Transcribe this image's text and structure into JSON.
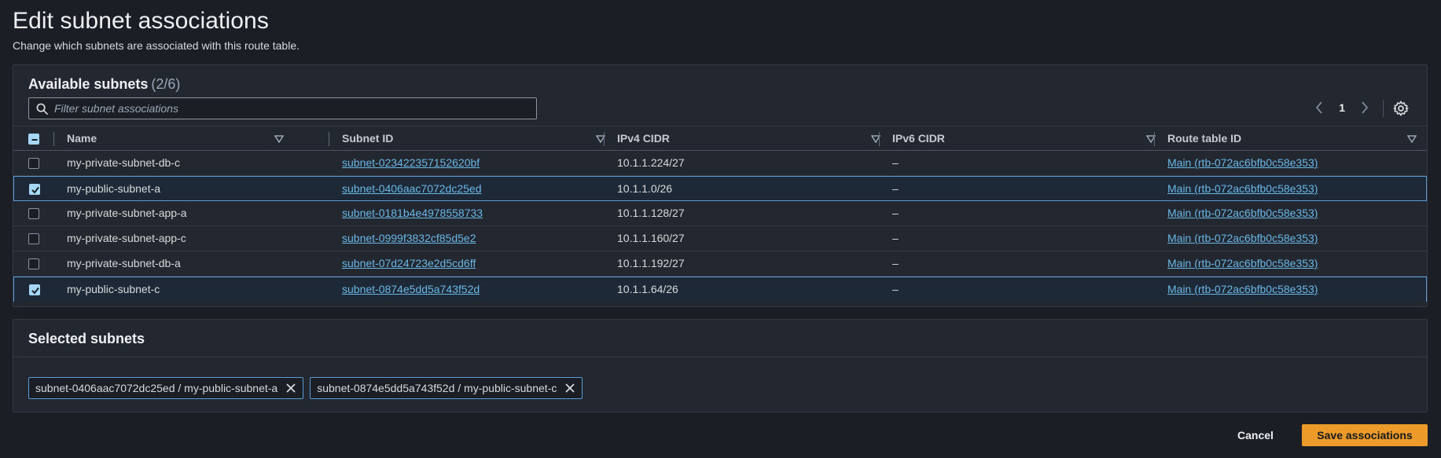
{
  "page": {
    "title": "Edit subnet associations",
    "subtitle": "Change which subnets are associated with this route table."
  },
  "available": {
    "title": "Available subnets",
    "count": "(2/6)",
    "filter_placeholder": "Filter subnet associations",
    "filter_value": "",
    "page_number": "1",
    "columns": [
      "Name",
      "Subnet ID",
      "IPv4 CIDR",
      "IPv6 CIDR",
      "Route table ID"
    ],
    "rows": [
      {
        "checked": false,
        "name": "my-private-subnet-db-c",
        "subnet_id": "subnet-02342235715262​0bf",
        "ipv4": "10.1.1.224/27",
        "ipv6": "–",
        "route_table": "Main (rtb-072ac6bfb0c58e353)"
      },
      {
        "checked": true,
        "name": "my-public-subnet-a",
        "subnet_id": "subnet-0406aac7072dc25ed",
        "ipv4": "10.1.1.0/26",
        "ipv6": "–",
        "route_table": "Main (rtb-072ac6bfb0c58e353)"
      },
      {
        "checked": false,
        "name": "my-private-subnet-app-a",
        "subnet_id": "subnet-0181b4e4978558733",
        "ipv4": "10.1.1.128/27",
        "ipv6": "–",
        "route_table": "Main (rtb-072ac6bfb0c58e353)"
      },
      {
        "checked": false,
        "name": "my-private-subnet-app-c",
        "subnet_id": "subnet-0999f3832cf85d5e2",
        "ipv4": "10.1.1.160/27",
        "ipv6": "–",
        "route_table": "Main (rtb-072ac6bfb0c58e353)"
      },
      {
        "checked": false,
        "name": "my-private-subnet-db-a",
        "subnet_id": "subnet-07d24723e2d5cd6ff",
        "ipv4": "10.1.1.192/27",
        "ipv6": "–",
        "route_table": "Main (rtb-072ac6bfb0c58e353)"
      },
      {
        "checked": true,
        "name": "my-public-subnet-c",
        "subnet_id": "subnet-0874e5dd5a743f52d",
        "ipv4": "10.1.1.64/26",
        "ipv6": "–",
        "route_table": "Main (rtb-072ac6bfb0c58e353)"
      }
    ]
  },
  "selected": {
    "title": "Selected subnets",
    "tokens": [
      "subnet-0406aac7072dc25ed / my-public-subnet-a",
      "subnet-0874e5dd5a743f52d / my-public-subnet-c"
    ]
  },
  "footer": {
    "cancel_label": "Cancel",
    "save_label": "Save associations"
  },
  "colors": {
    "accent": "#ec9b2a",
    "link": "#6ab7e6",
    "selected_border": "#5a9bd5",
    "checkbox_checked": "#a6d8f5"
  }
}
